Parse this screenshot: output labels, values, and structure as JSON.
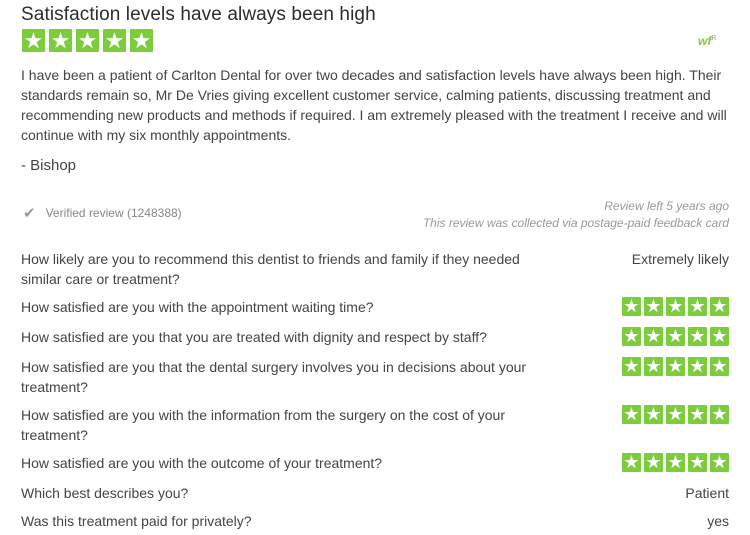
{
  "review": {
    "title": "Satisfaction levels have always been high",
    "overall_rating": 5,
    "logo_text": "wf",
    "logo_sup": "R",
    "body": "I have been a patient of Carlton Dental for over two decades and satisfaction levels have always been high. Their standards remain so, Mr De Vries giving excellent customer service, calming patients, discussing treatment and recommending new products and methods if required. I am extremely pleased with the treatment I receive and will continue with my six monthly appointments.",
    "author": "- Bishop",
    "verified": "Verified review (1248388)",
    "review_left": "Review left 5 years ago",
    "collected_via": "This review was collected via postage-paid feedback card"
  },
  "questions": [
    {
      "q": "How likely are you to recommend this dentist to friends and family if they needed similar care or treatment?",
      "a": "Extremely likely"
    },
    {
      "q": "How satisfied are you with the appointment waiting time?",
      "rating": 5
    },
    {
      "q": "How satisfied are you that you are treated with dignity and respect by staff?",
      "rating": 5
    },
    {
      "q": "How satisfied are you that the dental surgery involves you in decisions about your treatment?",
      "rating": 5
    },
    {
      "q": "How satisfied are you with the information from the surgery on the cost of your treatment?",
      "rating": 5
    },
    {
      "q": "How satisfied are you with the outcome of your treatment?",
      "rating": 5
    },
    {
      "q": "Which best describes you?",
      "a": "Patient"
    },
    {
      "q": "Was this treatment paid for privately?",
      "a": "yes"
    }
  ],
  "icons": {
    "star": "star-icon",
    "check": "checkmark-icon"
  },
  "colors": {
    "star_green": "#7ccc3c",
    "logo_green": "#8cc63f"
  }
}
